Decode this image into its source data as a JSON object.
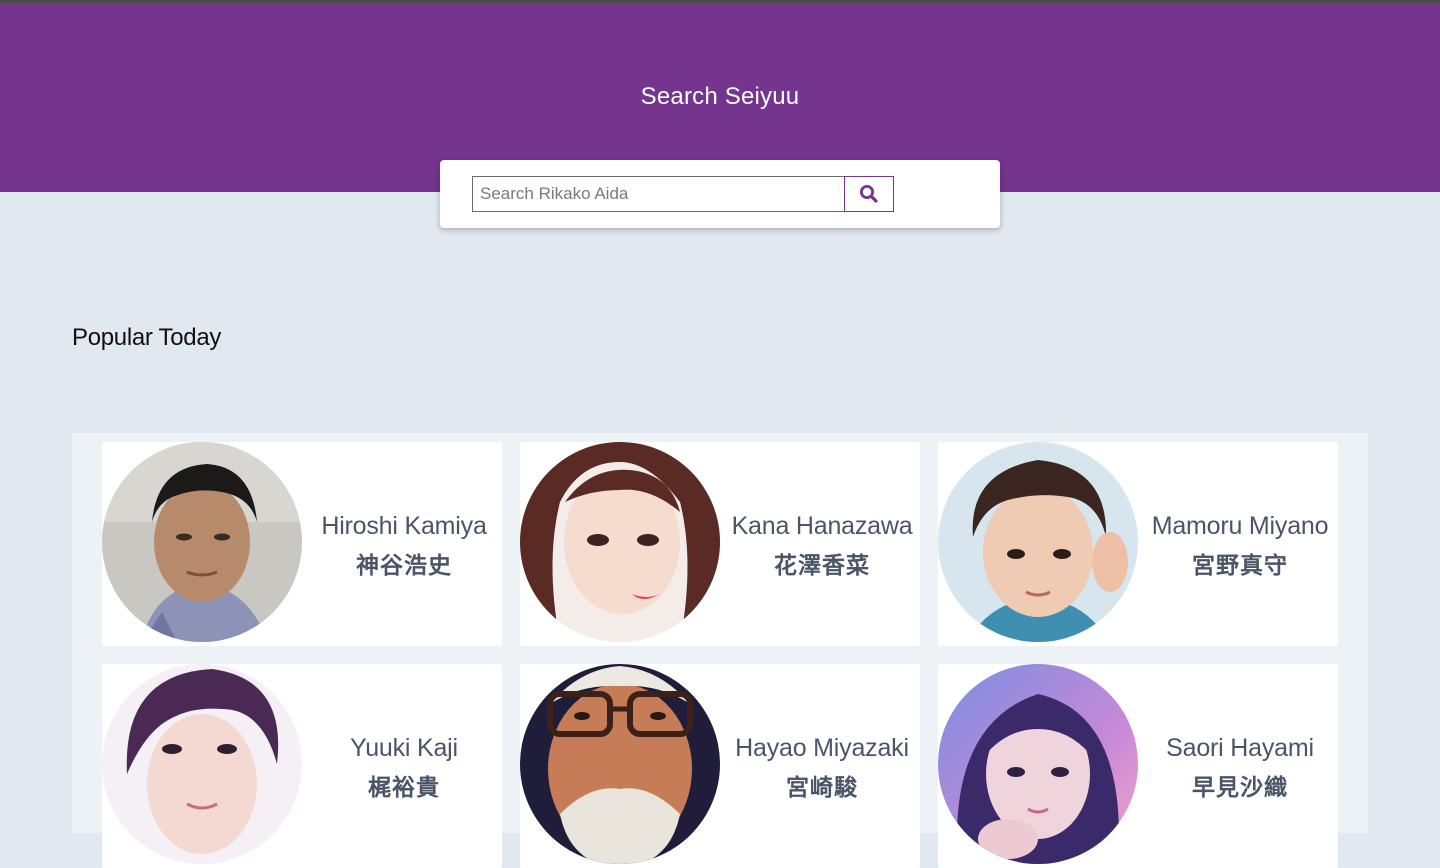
{
  "header": {
    "title": "Search Seiyuu",
    "background": "#75348d"
  },
  "search": {
    "placeholder": "Search Rikako Aida",
    "value": "",
    "button_icon": "search-icon"
  },
  "popular": {
    "title": "Popular Today",
    "cards": [
      {
        "name_en": "Hiroshi Kamiya",
        "name_jp": "神谷浩史"
      },
      {
        "name_en": "Kana Hanazawa",
        "name_jp": "花澤香菜"
      },
      {
        "name_en": "Mamoru Miyano",
        "name_jp": "宮野真守"
      },
      {
        "name_en": "Yuuki Kaji",
        "name_jp": "梶裕貴"
      },
      {
        "name_en": "Hayao Miyazaki",
        "name_jp": "宮崎駿"
      },
      {
        "name_en": "Saori Hayami",
        "name_jp": "早見沙織"
      }
    ]
  }
}
